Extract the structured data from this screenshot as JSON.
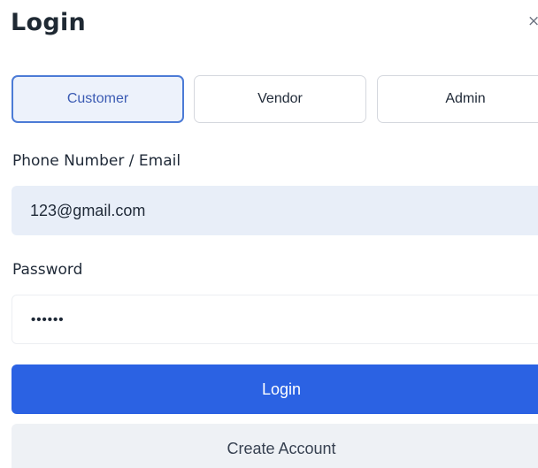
{
  "dialog": {
    "title": "Login",
    "close_symbol": "×"
  },
  "roles": {
    "selected": "Customer",
    "tabs": [
      {
        "label": "Customer"
      },
      {
        "label": "Vendor"
      },
      {
        "label": "Admin"
      }
    ]
  },
  "form": {
    "identifier_label": "Phone Number / Email",
    "identifier_value": "123@gmail.com",
    "password_label": "Password",
    "password_value": "••••••"
  },
  "actions": {
    "login_label": "Login",
    "create_account_label": "Create Account"
  },
  "colors": {
    "primary": "#2b62e3",
    "active_tab_border": "#4c7bd6",
    "active_tab_bg": "#edf2fb",
    "input_filled_bg": "#e8eef8",
    "secondary_button_bg": "#eef1f5"
  }
}
